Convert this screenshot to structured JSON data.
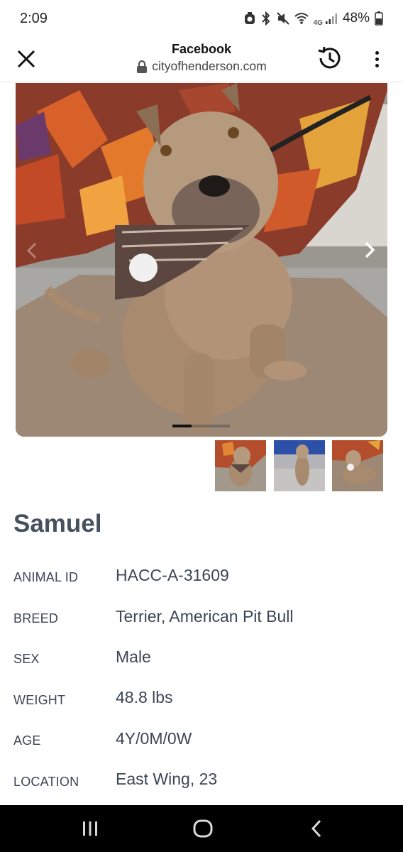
{
  "status_bar": {
    "time": "2:09",
    "network": "4G",
    "battery": "48%"
  },
  "browser": {
    "page_title": "Facebook",
    "url": "cityofhenderson.com"
  },
  "gallery": {
    "image_count": 3,
    "active_index": 0,
    "thumbnails": [
      "photo-1",
      "photo-2",
      "photo-3"
    ]
  },
  "animal": {
    "name": "Samuel",
    "details": [
      {
        "label": "ANIMAL ID",
        "value": "HACC-A-31609"
      },
      {
        "label": "BREED",
        "value": "Terrier, American Pit Bull"
      },
      {
        "label": "SEX",
        "value": "Male"
      },
      {
        "label": "WEIGHT",
        "value": "48.8 lbs"
      },
      {
        "label": "AGE",
        "value": "4Y/0M/0W"
      },
      {
        "label": "LOCATION",
        "value": "East Wing, 23"
      }
    ]
  },
  "colors": {
    "text_primary": "#46505f",
    "nav_bar": "#000000"
  },
  "icons": {
    "close": "close-icon",
    "lock": "lock-icon",
    "history": "history-icon",
    "more": "more-vert-icon",
    "next": "chevron-right-icon",
    "prev": "chevron-left-icon",
    "recents": "recents-icon",
    "home": "home-icon",
    "back": "back-icon"
  }
}
